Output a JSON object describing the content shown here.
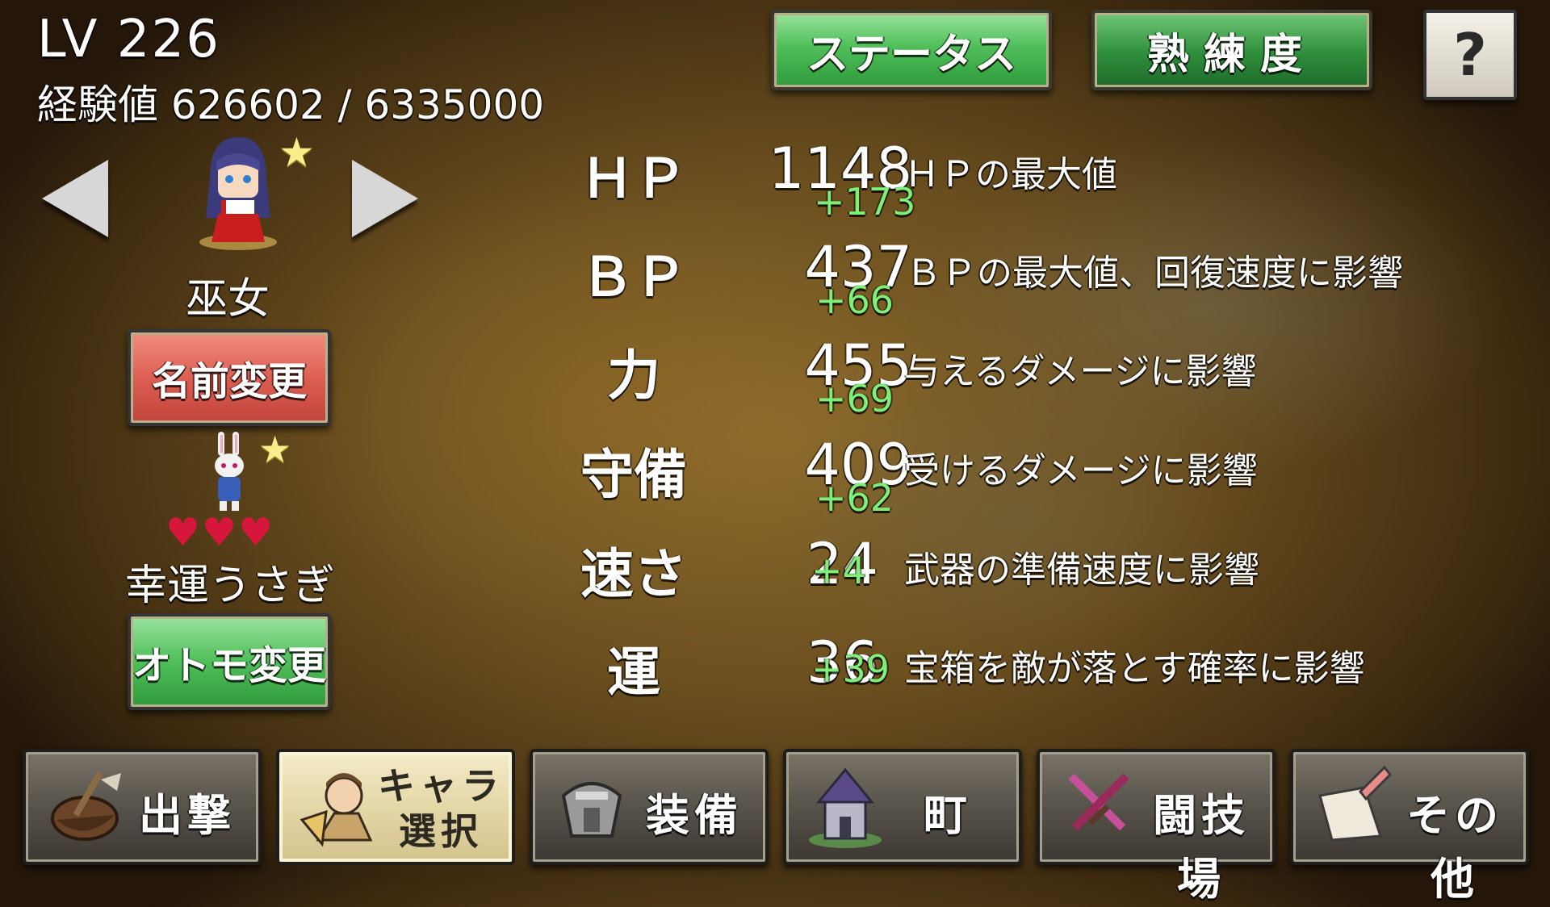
{
  "header": {
    "level": "LV 226",
    "exp": "経験値 626602 / 6335000"
  },
  "top_buttons": {
    "status": "ステータス",
    "mastery": "熟練度",
    "help": "?"
  },
  "character": {
    "class_name": "巫女",
    "rename_button": "名前変更",
    "pet_name": "幸運うさぎ",
    "pet_hearts": 3,
    "pet_change_button": "オトモ変更"
  },
  "stats": [
    {
      "label": "ＨＰ",
      "value": "1148",
      "bonus": "+173",
      "desc": "ＨＰの最大値"
    },
    {
      "label": "ＢＰ",
      "value": "437",
      "bonus": "+66",
      "desc": "ＢＰの最大値、回復速度に影響"
    },
    {
      "label": "力",
      "value": "455",
      "bonus": "+69",
      "desc": "与えるダメージに影響"
    },
    {
      "label": "守備",
      "value": "409",
      "bonus": "+62",
      "desc": "受けるダメージに影響"
    },
    {
      "label": "速さ",
      "value": "24",
      "bonus": "+4",
      "desc": "武器の準備速度に影響"
    },
    {
      "label": "運",
      "value": "36",
      "bonus": "+39",
      "desc": "宝箱を敵が落とす確率に影響"
    }
  ],
  "nav": [
    {
      "label": "出撃",
      "icon": "sortie-icon"
    },
    {
      "label": "キャラ\n選択",
      "icon": "character-select-icon",
      "active": true
    },
    {
      "label": "装備",
      "icon": "equipment-icon"
    },
    {
      "label": "町",
      "icon": "town-icon"
    },
    {
      "label": "闘技場",
      "icon": "arena-icon"
    },
    {
      "label": "その他",
      "icon": "other-icon"
    }
  ]
}
